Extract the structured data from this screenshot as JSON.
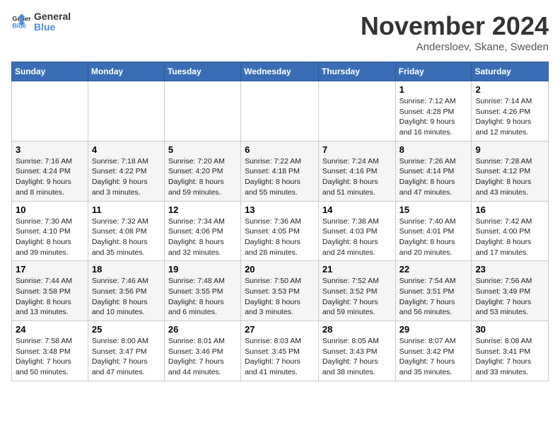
{
  "logo": {
    "line1": "General",
    "line2": "Blue"
  },
  "title": "November 2024",
  "location": "Andersloev, Skane, Sweden",
  "weekdays": [
    "Sunday",
    "Monday",
    "Tuesday",
    "Wednesday",
    "Thursday",
    "Friday",
    "Saturday"
  ],
  "weeks": [
    [
      {
        "day": "",
        "info": ""
      },
      {
        "day": "",
        "info": ""
      },
      {
        "day": "",
        "info": ""
      },
      {
        "day": "",
        "info": ""
      },
      {
        "day": "",
        "info": ""
      },
      {
        "day": "1",
        "info": "Sunrise: 7:12 AM\nSunset: 4:28 PM\nDaylight: 9 hours and 16 minutes."
      },
      {
        "day": "2",
        "info": "Sunrise: 7:14 AM\nSunset: 4:26 PM\nDaylight: 9 hours and 12 minutes."
      }
    ],
    [
      {
        "day": "3",
        "info": "Sunrise: 7:16 AM\nSunset: 4:24 PM\nDaylight: 9 hours and 8 minutes."
      },
      {
        "day": "4",
        "info": "Sunrise: 7:18 AM\nSunset: 4:22 PM\nDaylight: 9 hours and 3 minutes."
      },
      {
        "day": "5",
        "info": "Sunrise: 7:20 AM\nSunset: 4:20 PM\nDaylight: 8 hours and 59 minutes."
      },
      {
        "day": "6",
        "info": "Sunrise: 7:22 AM\nSunset: 4:18 PM\nDaylight: 8 hours and 55 minutes."
      },
      {
        "day": "7",
        "info": "Sunrise: 7:24 AM\nSunset: 4:16 PM\nDaylight: 8 hours and 51 minutes."
      },
      {
        "day": "8",
        "info": "Sunrise: 7:26 AM\nSunset: 4:14 PM\nDaylight: 8 hours and 47 minutes."
      },
      {
        "day": "9",
        "info": "Sunrise: 7:28 AM\nSunset: 4:12 PM\nDaylight: 8 hours and 43 minutes."
      }
    ],
    [
      {
        "day": "10",
        "info": "Sunrise: 7:30 AM\nSunset: 4:10 PM\nDaylight: 8 hours and 39 minutes."
      },
      {
        "day": "11",
        "info": "Sunrise: 7:32 AM\nSunset: 4:08 PM\nDaylight: 8 hours and 35 minutes."
      },
      {
        "day": "12",
        "info": "Sunrise: 7:34 AM\nSunset: 4:06 PM\nDaylight: 8 hours and 32 minutes."
      },
      {
        "day": "13",
        "info": "Sunrise: 7:36 AM\nSunset: 4:05 PM\nDaylight: 8 hours and 28 minutes."
      },
      {
        "day": "14",
        "info": "Sunrise: 7:38 AM\nSunset: 4:03 PM\nDaylight: 8 hours and 24 minutes."
      },
      {
        "day": "15",
        "info": "Sunrise: 7:40 AM\nSunset: 4:01 PM\nDaylight: 8 hours and 20 minutes."
      },
      {
        "day": "16",
        "info": "Sunrise: 7:42 AM\nSunset: 4:00 PM\nDaylight: 8 hours and 17 minutes."
      }
    ],
    [
      {
        "day": "17",
        "info": "Sunrise: 7:44 AM\nSunset: 3:58 PM\nDaylight: 8 hours and 13 minutes."
      },
      {
        "day": "18",
        "info": "Sunrise: 7:46 AM\nSunset: 3:56 PM\nDaylight: 8 hours and 10 minutes."
      },
      {
        "day": "19",
        "info": "Sunrise: 7:48 AM\nSunset: 3:55 PM\nDaylight: 8 hours and 6 minutes."
      },
      {
        "day": "20",
        "info": "Sunrise: 7:50 AM\nSunset: 3:53 PM\nDaylight: 8 hours and 3 minutes."
      },
      {
        "day": "21",
        "info": "Sunrise: 7:52 AM\nSunset: 3:52 PM\nDaylight: 7 hours and 59 minutes."
      },
      {
        "day": "22",
        "info": "Sunrise: 7:54 AM\nSunset: 3:51 PM\nDaylight: 7 hours and 56 minutes."
      },
      {
        "day": "23",
        "info": "Sunrise: 7:56 AM\nSunset: 3:49 PM\nDaylight: 7 hours and 53 minutes."
      }
    ],
    [
      {
        "day": "24",
        "info": "Sunrise: 7:58 AM\nSunset: 3:48 PM\nDaylight: 7 hours and 50 minutes."
      },
      {
        "day": "25",
        "info": "Sunrise: 8:00 AM\nSunset: 3:47 PM\nDaylight: 7 hours and 47 minutes."
      },
      {
        "day": "26",
        "info": "Sunrise: 8:01 AM\nSunset: 3:46 PM\nDaylight: 7 hours and 44 minutes."
      },
      {
        "day": "27",
        "info": "Sunrise: 8:03 AM\nSunset: 3:45 PM\nDaylight: 7 hours and 41 minutes."
      },
      {
        "day": "28",
        "info": "Sunrise: 8:05 AM\nSunset: 3:43 PM\nDaylight: 7 hours and 38 minutes."
      },
      {
        "day": "29",
        "info": "Sunrise: 8:07 AM\nSunset: 3:42 PM\nDaylight: 7 hours and 35 minutes."
      },
      {
        "day": "30",
        "info": "Sunrise: 8:08 AM\nSunset: 3:41 PM\nDaylight: 7 hours and 33 minutes."
      }
    ]
  ]
}
